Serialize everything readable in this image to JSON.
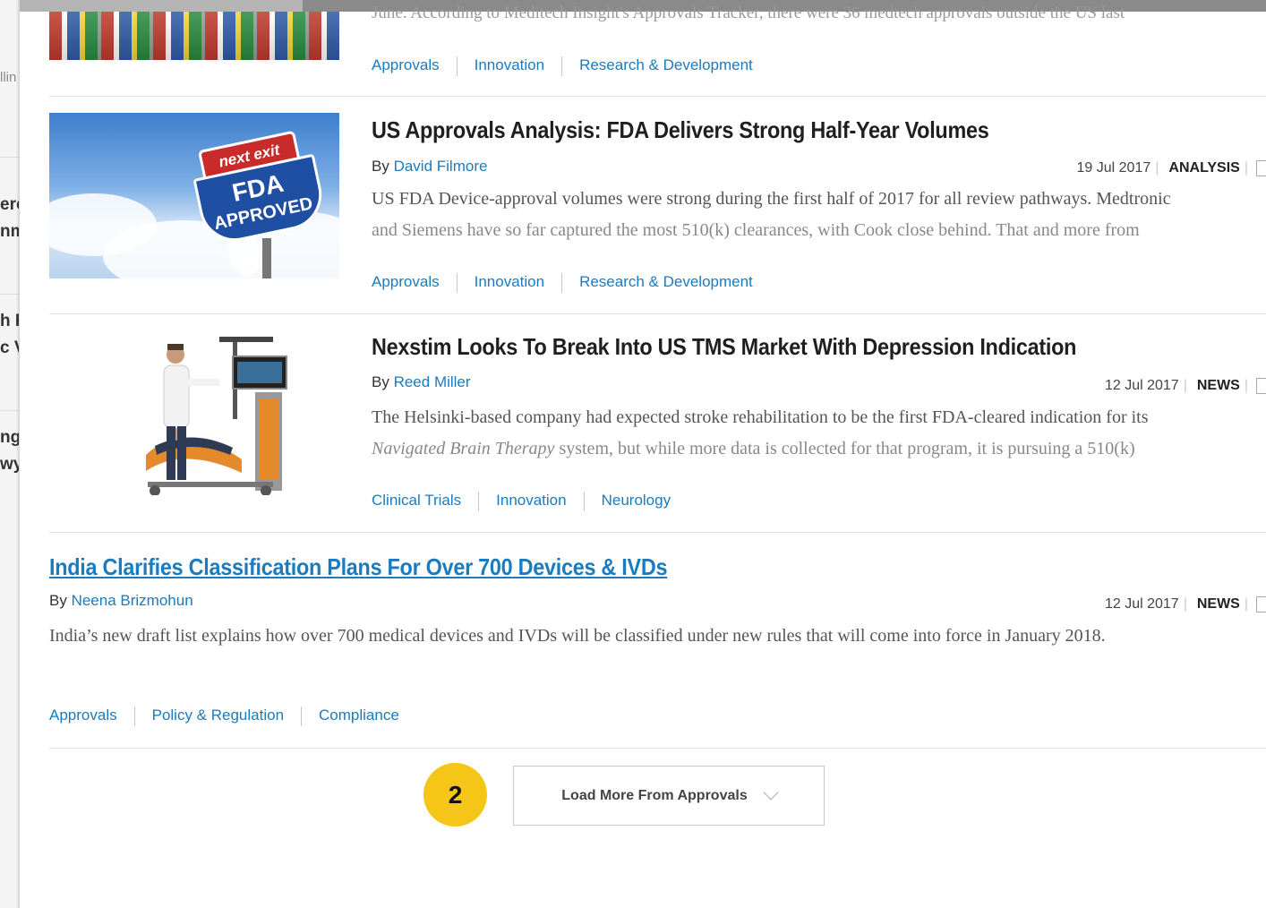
{
  "left_fragments": [
    {
      "text": "llin",
      "small": true
    },
    {
      "text": "ero"
    },
    {
      "text": "nm"
    },
    {
      "text": "h P"
    },
    {
      "text": "c V"
    },
    {
      "text": "ng"
    },
    {
      "text": "wyr"
    }
  ],
  "top_teaser": {
    "line1": "June. According to Meditech Insight's Approvals Tracker, there were 36 medtech approvals outside the US last",
    "tags": [
      "Approvals",
      "Innovation",
      "Research & Development"
    ]
  },
  "articles": [
    {
      "title": "US Approvals Analysis: FDA Delivers Strong Half-Year Volumes",
      "by": "By",
      "author": "David Filmore",
      "date": "19 Jul 2017",
      "type": "ANALYSIS",
      "summary_line1": "US FDA Device-approval volumes were strong during the first half of 2017 for all review pathways. Medtronic",
      "summary_line2": "and Siemens have so far captured the most 510(k) clearances, with Cook close behind. That and more from",
      "tags": [
        "Approvals",
        "Innovation",
        "Research & Development"
      ],
      "thumb": {
        "sign_top": "next exit",
        "sign_main1": "FDA",
        "sign_main2": "APPROVED"
      }
    },
    {
      "title": "Nexstim Looks To Break Into US TMS Market With Depression Indication",
      "by": "By",
      "author": "Reed Miller",
      "date": "12 Jul 2017",
      "type": "NEWS",
      "summary_line1": "The Helsinki-based company had expected stroke rehabilitation to be the first FDA-cleared indication for its",
      "summary_line2_em": "Navigated Brain Therapy",
      "summary_line2_rest": " system, but while more data is collected for that program, it is pursuing a 510(k)",
      "tags": [
        "Clinical Trials",
        "Innovation",
        "Neurology"
      ]
    },
    {
      "title": "India Clarifies Classification Plans For Over 700 Devices & IVDs",
      "by": "By",
      "author": "Neena Brizmohun",
      "date": "12 Jul 2017",
      "type": "NEWS",
      "summary_line1": "India’s new draft list explains how over 700 medical devices and IVDs will be classified under new rules that will come into force in January 2018.",
      "tags": [
        "Approvals",
        "Policy & Regulation",
        "Compliance"
      ]
    }
  ],
  "load_more": {
    "label": "Load More From Approvals"
  },
  "badge": {
    "number": "2"
  },
  "colors": {
    "link": "#1a7bbf",
    "badge": "#f5c518"
  }
}
